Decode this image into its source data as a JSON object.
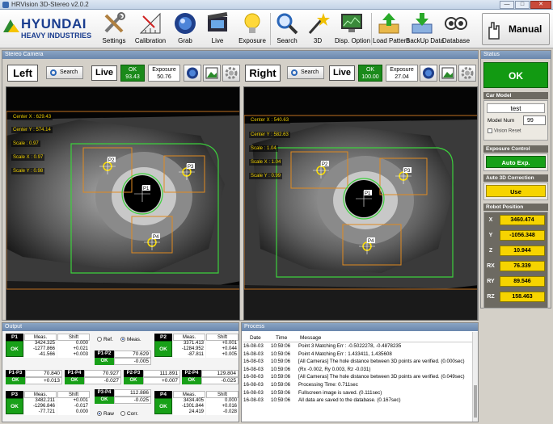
{
  "window": {
    "title": "HRVision 3D-Stereo v2.0.2"
  },
  "logo": {
    "line1": "HYUNDAI",
    "line2": "HEAVY INDUSTRIES"
  },
  "toolbar": {
    "items": [
      {
        "label": "Settings",
        "icon": "tools-icon"
      },
      {
        "label": "Calibration",
        "icon": "ruler-icon"
      },
      {
        "label": "Grab",
        "icon": "grab-icon"
      },
      {
        "label": "Live",
        "icon": "film-icon"
      },
      {
        "label": "Exposure",
        "icon": "bulb-icon"
      },
      {
        "label": "Search",
        "icon": "search-icon"
      },
      {
        "label": "3D",
        "icon": "wand-icon"
      },
      {
        "label": "Disp. Option",
        "icon": "monitor-icon"
      },
      {
        "label": "Load Pattern",
        "icon": "load-icon"
      },
      {
        "label": "BackUp Data",
        "icon": "backup-icon"
      },
      {
        "label": "Database",
        "icon": "database-icon"
      }
    ],
    "manual_label": "Manual"
  },
  "stereo": {
    "title": "Stereo Camera",
    "left": {
      "side": "Left",
      "search": "Search",
      "live": "Live",
      "ok_label": "OK",
      "ok_value": "93.43",
      "exposure_label": "Exposure",
      "exposure_value": "50.76",
      "center_x": "Center X : 629.43",
      "center_y": "Center Y : 574.14",
      "scale": "Scale  : 0.97",
      "scale_x": "Scale X : 0.97",
      "scale_y": "Scale Y : 0.98",
      "markers": [
        "P1",
        "P2",
        "P3",
        "P4"
      ]
    },
    "right": {
      "side": "Right",
      "search": "Search",
      "live": "Live",
      "ok_label": "OK",
      "ok_value": "100.00",
      "exposure_label": "Exposure",
      "exposure_value": "27.04",
      "center_x": "Center X : 540.63",
      "center_y": "Center Y : 582.63",
      "scale": "Scale  : 1.04",
      "scale_x": "Scale X : 1.04",
      "scale_y": "Scale Y : 0.99",
      "markers": [
        "P1",
        "P2",
        "P3",
        "P4"
      ]
    }
  },
  "status": {
    "title": "Status",
    "result": "OK",
    "car_model_title": "Car Model",
    "car_model": "test",
    "model_num_label": "Model Num",
    "model_num": "99",
    "vision_reset": "Vision Reset",
    "exposure_title": "Exposure Control",
    "exposure_btn": "Auto Exp.",
    "auto3d_title": "Auto 3D Correction",
    "auto3d_btn": "Use",
    "robot_title": "Robot Position",
    "robot": [
      {
        "axis": "X",
        "value": "3460.474"
      },
      {
        "axis": "Y",
        "value": "-1056.348"
      },
      {
        "axis": "Z",
        "value": "10.944"
      },
      {
        "axis": "RX",
        "value": "76.339"
      },
      {
        "axis": "RY",
        "value": "89.546"
      },
      {
        "axis": "RZ",
        "value": "158.463"
      }
    ]
  },
  "output": {
    "title": "Output",
    "meas_h": "Meas.",
    "shift_h": "Shift",
    "ok": "OK",
    "p1": {
      "label": "P1",
      "meas": [
        "3424.325",
        "-1277.866",
        "-41.566"
      ],
      "shift": [
        "0.000",
        "+0.021",
        "+0.003"
      ]
    },
    "p2": {
      "label": "P2",
      "meas": [
        "3371.413",
        "-1284.952",
        "-87.811"
      ],
      "shift": [
        "+0.001",
        "+0.044",
        "+0.005"
      ]
    },
    "p3": {
      "label": "P3",
      "meas": [
        "3482.211",
        "-1296.846",
        "-77.721"
      ],
      "shift": [
        "+0.001",
        "-0.017",
        "0.000"
      ]
    },
    "p4": {
      "label": "P4",
      "meas": [
        "3434.405",
        "-1301.844",
        "24.419"
      ],
      "shift": [
        "0.000",
        "+0.016",
        "-0.028"
      ]
    },
    "ref": "Ref.",
    "meas_radio": "Meas.",
    "raw": "Raw",
    "corr": "Corr.",
    "pairs": [
      {
        "label": "P1-P2",
        "meas": "70.629",
        "shift": "-0.005"
      },
      {
        "label": "P1-P3",
        "meas": "70.840",
        "shift": "+0.013"
      },
      {
        "label": "P1-P4",
        "meas": "70.927",
        "shift": "-0.027"
      },
      {
        "label": "P2-P3",
        "meas": "111.891",
        "shift": "+0.007"
      },
      {
        "label": "P2-P4",
        "meas": "129.804",
        "shift": "-0.025"
      },
      {
        "label": "P3-P4",
        "meas": "112.886",
        "shift": "-0.025"
      }
    ]
  },
  "process": {
    "title": "Process",
    "headers": {
      "date": "Date",
      "time": "Time",
      "message": "Message"
    },
    "rows": [
      {
        "date": "16-08-03",
        "time": "10:59:06",
        "message": "Point 3 Matching Err : -0.5022278, -0.4878235"
      },
      {
        "date": "16-08-03",
        "time": "10:59:06",
        "message": "Point 4 Matching Err : 1.433411, 1.435608"
      },
      {
        "date": "16-08-03",
        "time": "10:59:06",
        "message": "[All Cameras] The hole distance between 3D points are verified. (0.000sec)"
      },
      {
        "date": "16-08-03",
        "time": "10:59:06",
        "message": "(Rx -0.002, Ry 0.003, Rz -0.031)"
      },
      {
        "date": "16-08-03",
        "time": "10:59:06",
        "message": "[All Cameras] The hole distance between 3D points are verified. (0.049sec)"
      },
      {
        "date": "16-08-03",
        "time": "10:59:06",
        "message": "Processing Time: 0.711sec"
      },
      {
        "date": "16-08-03",
        "time": "10:59:06",
        "message": "Fullscreen image is saved. (0.111sec)"
      },
      {
        "date": "16-08-03",
        "time": "10:59:06",
        "message": "All data are saved to the database. (0.167sec)"
      }
    ]
  },
  "colors": {
    "ok_green": "#18a018",
    "robot_yellow": "#f6d400",
    "marker_green": "#3cd03c",
    "roi_orange": "#e08a20"
  }
}
